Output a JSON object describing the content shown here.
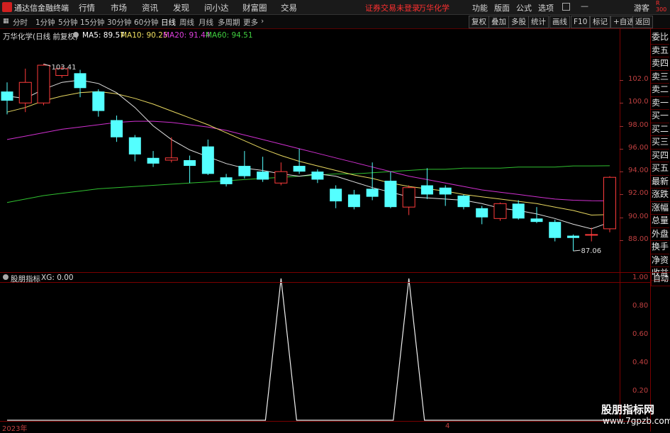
{
  "app": {
    "title": "通达信金融终端",
    "warning": "证券交易未登录",
    "stock_name": "万华化学"
  },
  "menu": [
    "行情",
    "市场",
    "资讯",
    "发现",
    "问小达",
    "财富圈",
    "交易"
  ],
  "right_menu": [
    "功能",
    "版面",
    "公式",
    "选项"
  ],
  "user_label": "游客",
  "periods": [
    "分时",
    "1分钟",
    "5分钟",
    "15分钟",
    "30分钟",
    "60分钟",
    "日线",
    "周线",
    "月线",
    "多周期",
    "更多"
  ],
  "active_period": "日线",
  "tools": [
    "复权",
    "叠加",
    "多股",
    "统计",
    "画线",
    "F10",
    "标记",
    "+自选",
    "返回"
  ],
  "main_header": "万华化学(日线 前复权)",
  "ma": [
    {
      "label": "MA5: 89.57",
      "color": "#ffffff"
    },
    {
      "label": "MA10: 90.25",
      "color": "#f0e060"
    },
    {
      "label": "MA20: 91.44",
      "color": "#e040e0"
    },
    {
      "label": "MA60: 94.51",
      "color": "#40d040"
    }
  ],
  "price_ticks": [
    "102.0",
    "100.0",
    "98.00",
    "96.00",
    "94.00",
    "92.00",
    "90.00",
    "88.00"
  ],
  "high_label": "103.41",
  "low_label": "87.06",
  "indicator": {
    "name": "股朋指标",
    "value_label": "XG: 0.00",
    "ticks": [
      "1.00",
      "0.80",
      "0.60",
      "0.40",
      "0.20"
    ]
  },
  "date_labels": [
    "2023年",
    "4"
  ],
  "side_panel": [
    "委比",
    "卖五",
    "卖四",
    "卖三",
    "卖二",
    "卖一",
    "买一",
    "买二",
    "买三",
    "买四",
    "买五",
    "最新",
    "涨跌",
    "涨幅",
    "总量",
    "外盘",
    "换手",
    "净资",
    "收益"
  ],
  "side_top": "300",
  "side_button": "自动",
  "watermark": {
    "line1": "股朋指标网",
    "line2": "www.7gpzb.com"
  },
  "chart_data": {
    "type": "candlestick",
    "candles": [
      {
        "o": 101.0,
        "c": 100.2,
        "h": 101.8,
        "l": 99.0
      },
      {
        "o": 100.0,
        "c": 101.8,
        "h": 103.0,
        "l": 99.2
      },
      {
        "o": 100.0,
        "c": 103.3,
        "h": 103.41,
        "l": 99.8
      },
      {
        "o": 102.4,
        "c": 103.0,
        "h": 103.2,
        "l": 102.2
      },
      {
        "o": 102.6,
        "c": 101.3,
        "h": 102.9,
        "l": 100.5
      },
      {
        "o": 101.0,
        "c": 99.3,
        "h": 101.2,
        "l": 98.8
      },
      {
        "o": 98.5,
        "c": 97.0,
        "h": 98.9,
        "l": 96.6
      },
      {
        "o": 97.0,
        "c": 95.5,
        "h": 97.2,
        "l": 94.9
      },
      {
        "o": 95.2,
        "c": 94.7,
        "h": 95.8,
        "l": 94.4
      },
      {
        "o": 95.0,
        "c": 95.2,
        "h": 97.0,
        "l": 94.8
      },
      {
        "o": 95.0,
        "c": 94.5,
        "h": 95.4,
        "l": 93.0
      },
      {
        "o": 96.2,
        "c": 93.8,
        "h": 96.8,
        "l": 93.7
      },
      {
        "o": 93.5,
        "c": 92.9,
        "h": 93.8,
        "l": 92.7
      },
      {
        "o": 94.5,
        "c": 93.6,
        "h": 95.8,
        "l": 93.4
      },
      {
        "o": 94.0,
        "c": 93.3,
        "h": 95.3,
        "l": 93.1
      },
      {
        "o": 93.0,
        "c": 94.0,
        "h": 94.8,
        "l": 92.8
      },
      {
        "o": 94.5,
        "c": 94.0,
        "h": 96.0,
        "l": 93.8
      },
      {
        "o": 94.0,
        "c": 93.3,
        "h": 94.2,
        "l": 93.0
      },
      {
        "o": 92.5,
        "c": 91.4,
        "h": 92.8,
        "l": 90.8
      },
      {
        "o": 92.0,
        "c": 90.9,
        "h": 92.4,
        "l": 90.7
      },
      {
        "o": 92.5,
        "c": 91.8,
        "h": 94.8,
        "l": 91.5
      },
      {
        "o": 93.2,
        "c": 90.9,
        "h": 94.0,
        "l": 90.8
      },
      {
        "o": 90.9,
        "c": 92.6,
        "h": 92.8,
        "l": 90.2
      },
      {
        "o": 92.8,
        "c": 92.0,
        "h": 94.3,
        "l": 91.6
      },
      {
        "o": 92.6,
        "c": 92.0,
        "h": 92.8,
        "l": 91.0
      },
      {
        "o": 91.9,
        "c": 90.9,
        "h": 92.0,
        "l": 90.7
      },
      {
        "o": 90.8,
        "c": 90.0,
        "h": 91.0,
        "l": 89.4
      },
      {
        "o": 89.9,
        "c": 91.2,
        "h": 91.3,
        "l": 89.7
      },
      {
        "o": 91.2,
        "c": 89.9,
        "h": 91.5,
        "l": 89.8
      },
      {
        "o": 89.9,
        "c": 89.6,
        "h": 90.9,
        "l": 89.5
      },
      {
        "o": 89.6,
        "c": 88.2,
        "h": 89.8,
        "l": 87.9
      },
      {
        "o": 88.4,
        "c": 88.2,
        "h": 88.5,
        "l": 87.06
      },
      {
        "o": 88.5,
        "c": 88.5,
        "h": 89.1,
        "l": 87.9
      },
      {
        "o": 89.0,
        "c": 93.5,
        "h": 93.6,
        "l": 88.7
      }
    ],
    "ma5": [
      100.6,
      100.4,
      101.2,
      101.8,
      102.0,
      101.7,
      100.9,
      99.6,
      98.0,
      96.8,
      95.9,
      95.3,
      94.7,
      94.3,
      94.1,
      93.8,
      93.6,
      93.8,
      93.6,
      93.1,
      92.6,
      92.2,
      91.8,
      91.7,
      91.6,
      91.5,
      91.2,
      90.8,
      90.6,
      90.3,
      89.9,
      89.4,
      89.0,
      89.57
    ],
    "ma10": [
      99.2,
      99.6,
      100.2,
      100.6,
      100.9,
      101.0,
      100.8,
      100.4,
      99.9,
      99.3,
      98.7,
      98.1,
      97.4,
      96.7,
      96.0,
      95.4,
      94.9,
      94.5,
      94.1,
      93.7,
      93.4,
      93.0,
      92.7,
      92.5,
      92.3,
      92.0,
      91.8,
      91.6,
      91.4,
      91.2,
      90.9,
      90.6,
      90.2,
      90.25
    ],
    "ma20": [
      96.8,
      97.1,
      97.4,
      97.7,
      97.9,
      98.1,
      98.3,
      98.4,
      98.4,
      98.3,
      98.1,
      97.9,
      97.6,
      97.2,
      96.8,
      96.4,
      96.0,
      95.6,
      95.2,
      94.8,
      94.4,
      94.0,
      93.6,
      93.3,
      93.0,
      92.7,
      92.4,
      92.2,
      92.0,
      91.8,
      91.6,
      91.5,
      91.45,
      91.44
    ],
    "ma60": [
      91.3,
      91.6,
      91.9,
      92.1,
      92.3,
      92.5,
      92.6,
      92.7,
      92.8,
      92.9,
      93.0,
      93.1,
      93.2,
      93.3,
      93.4,
      93.5,
      93.6,
      93.7,
      93.8,
      93.8,
      93.9,
      94.0,
      94.1,
      94.2,
      94.2,
      94.3,
      94.3,
      94.3,
      94.4,
      94.4,
      94.4,
      94.5,
      94.5,
      94.51
    ],
    "xg": [
      0,
      0,
      0,
      0,
      0,
      0,
      0,
      0,
      0,
      0,
      0,
      0,
      0,
      0,
      0,
      1,
      0,
      0,
      0,
      0,
      0,
      0,
      1,
      0,
      0,
      0,
      0,
      0,
      0,
      0,
      0,
      0,
      0,
      0
    ],
    "ylim": [
      87.06,
      103.41
    ]
  }
}
